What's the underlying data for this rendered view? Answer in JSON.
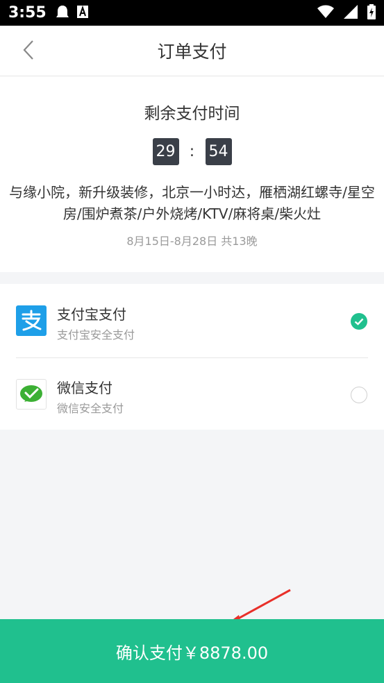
{
  "status_bar": {
    "time": "3:55",
    "icons": [
      "notification-ghost-icon",
      "font-a-icon",
      "wifi-icon",
      "signal-icon",
      "battery-charging-icon"
    ]
  },
  "header": {
    "title": "订单支付",
    "back_icon": "chevron-left-icon"
  },
  "order": {
    "countdown_label": "剩余支付时间",
    "minutes": "29",
    "separator": ":",
    "seconds": "54",
    "room_title": "与缘小院，新升级装修，北京一小时达，雁栖湖红螺寺/星空房/围炉煮茶/户外烧烤/KTV/麻将桌/柴火灶",
    "dates": "8月15日-8月28日  共13晚"
  },
  "payment_methods": [
    {
      "name": "支付宝支付",
      "desc": "支付宝安全支付",
      "selected": true,
      "icon": "alipay-icon",
      "color": "#1e9fe8"
    },
    {
      "name": "微信支付",
      "desc": "微信安全支付",
      "selected": false,
      "icon": "wechat-pay-icon",
      "color": "#3cb034"
    }
  ],
  "confirm": {
    "label": "确认支付￥8878.00"
  },
  "colors": {
    "accent": "#20c08e",
    "timer_bg": "#3a3f48"
  }
}
